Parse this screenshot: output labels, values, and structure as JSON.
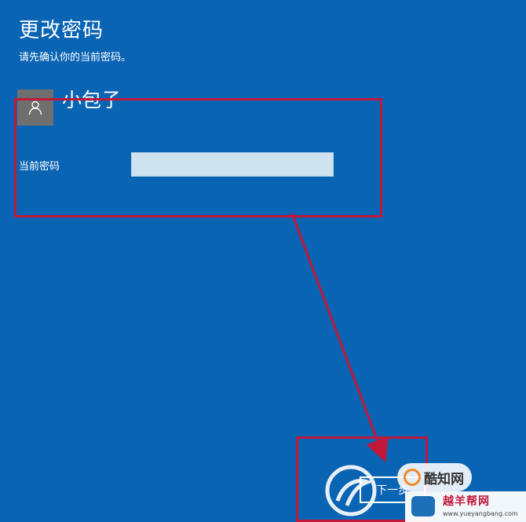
{
  "dialog": {
    "title": "更改密码",
    "subtitle": "请先确认你的当前密码。"
  },
  "account": {
    "icon": "user-icon",
    "username": "小包子"
  },
  "password": {
    "label": "当前密码",
    "value": "",
    "placeholder": ""
  },
  "actions": {
    "next_label": "下一步"
  },
  "annotations": {
    "highlight_color": "#c2183a"
  },
  "watermarks": {
    "kuzhi_text": "酷知网",
    "site_name": "越羊帮网",
    "site_url": "www.yueyangbang.com"
  },
  "colors": {
    "background": "#0a64b4",
    "input_fill": "#cfe2f0",
    "avatar_fill": "#6f6f6f"
  }
}
